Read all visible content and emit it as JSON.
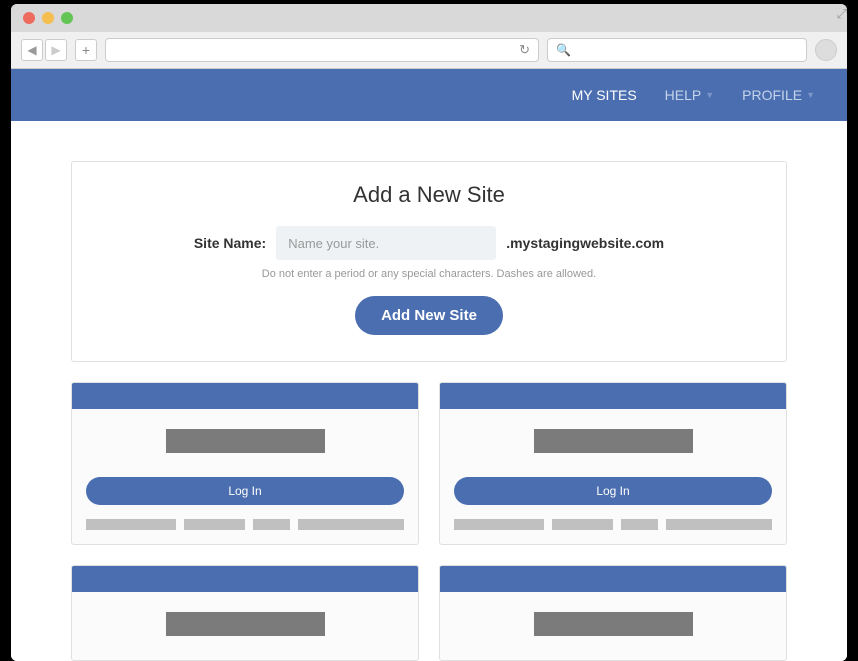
{
  "nav": {
    "my_sites": "MY SITES",
    "help": "HELP",
    "profile": "PROFILE"
  },
  "add_site": {
    "title": "Add a New Site",
    "label": "Site Name:",
    "placeholder": "Name your site.",
    "suffix": ".mystagingwebsite.com",
    "help": "Do not enter a period or any special characters. Dashes are allowed.",
    "button": "Add New Site"
  },
  "site_card": {
    "login": "Log In"
  }
}
